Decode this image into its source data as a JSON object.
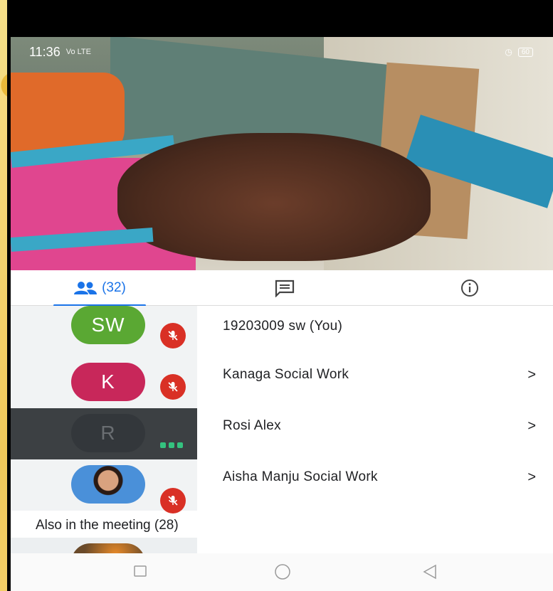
{
  "status_bar": {
    "time": "11:36",
    "signal": "Vo LTE",
    "battery": "60"
  },
  "tabs": {
    "people_count": "(32)",
    "people_icon": "people-icon",
    "chat_icon": "chat-icon",
    "info_icon": "info-icon"
  },
  "participants": [
    {
      "initials": "SW",
      "name": "19203009 sw (You)",
      "avatar_color": "#5aa833",
      "muted": true,
      "chevron": ""
    },
    {
      "initials": "K",
      "name": "Kanaga Social Work",
      "avatar_color": "#c8275a",
      "muted": true,
      "chevron": ">"
    },
    {
      "initials": "R",
      "name": "Rosi Alex",
      "avatar_color": "#33373b",
      "muted": false,
      "speaking": true,
      "chevron": ">"
    },
    {
      "initials": "",
      "name": "Aisha Manju Social Work",
      "avatar_color": "#4a90d9",
      "photo": true,
      "muted": true,
      "chevron": ">"
    }
  ],
  "also_in_meeting": "Also in the meeting (28)",
  "colors": {
    "accent": "#1a73e8",
    "mute_red": "#d93025",
    "speaking_green": "#34c27f"
  }
}
